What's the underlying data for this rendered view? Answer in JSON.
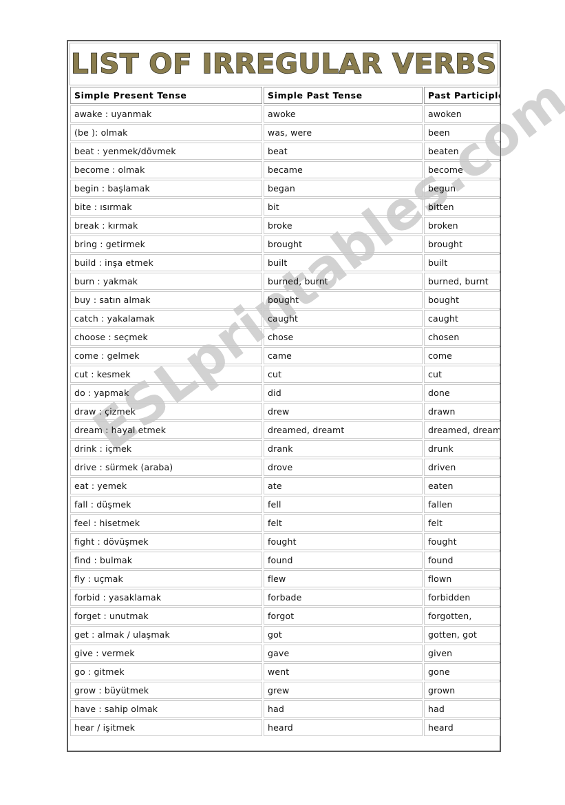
{
  "document": {
    "title": "LIST OF IRREGULAR VERBS",
    "title_color": "#8a7d4e",
    "title_outline_color": "#2a2a22",
    "page_border_color": "#595959",
    "cell_border_color": "#c9c9c9"
  },
  "watermark": {
    "text": "ESLprintables.com",
    "color": "#d2d2d2",
    "rotation_deg": -37
  },
  "table": {
    "columns": [
      "Simple Present Tense",
      "Simple Past Tense",
      "Past Participle"
    ],
    "rows": [
      [
        "awake : uyanmak",
        "awoke",
        "awoken"
      ],
      [
        "(be ): olmak",
        "was, were",
        "been"
      ],
      [
        "beat : yenmek/dövmek",
        "beat",
        "beaten"
      ],
      [
        "become : olmak",
        "became",
        "become"
      ],
      [
        "begin : başlamak",
        "began",
        "begun"
      ],
      [
        "bite : ısırmak",
        "bit",
        "bitten"
      ],
      [
        "break : kırmak",
        "broke",
        "broken"
      ],
      [
        "bring : getirmek",
        "brought",
        "brought"
      ],
      [
        "build : inşa etmek",
        "built",
        "built"
      ],
      [
        "burn : yakmak",
        "burned, burnt",
        "burned, burnt"
      ],
      [
        "buy : satın almak",
        "bought",
        "bought"
      ],
      [
        "catch : yakalamak",
        "caught",
        "caught"
      ],
      [
        "choose : seçmek",
        "chose",
        "chosen"
      ],
      [
        "come : gelmek",
        "came",
        "come"
      ],
      [
        "cut : kesmek",
        "cut",
        "cut"
      ],
      [
        "do : yapmak",
        "did",
        "done"
      ],
      [
        "draw : çizmek",
        "drew",
        "drawn"
      ],
      [
        "dream : hayal etmek",
        "dreamed, dreamt",
        "dreamed, dreamt"
      ],
      [
        "drink : içmek",
        "drank",
        "drunk"
      ],
      [
        "drive : sürmek (araba)",
        "drove",
        "driven"
      ],
      [
        "eat : yemek",
        "ate",
        "eaten"
      ],
      [
        "fall : düşmek",
        "fell",
        "fallen"
      ],
      [
        "feel : hisetmek",
        "felt",
        "felt"
      ],
      [
        "fight : dövüşmek",
        "fought",
        "fought"
      ],
      [
        "find : bulmak",
        "found",
        "found"
      ],
      [
        "fly : uçmak",
        "flew",
        "flown"
      ],
      [
        "forbid : yasaklamak",
        "forbade",
        "forbidden"
      ],
      [
        "forget : unutmak",
        "forgot",
        "forgotten,"
      ],
      [
        "get : almak / ulaşmak",
        "got",
        "gotten, got"
      ],
      [
        "give : vermek",
        "gave",
        "given"
      ],
      [
        "go : gitmek",
        "went",
        "gone"
      ],
      [
        "grow : büyütmek",
        "grew",
        "grown"
      ],
      [
        "have : sahip olmak",
        "had",
        "had"
      ],
      [
        "hear / işitmek",
        "heard",
        "heard"
      ]
    ]
  }
}
